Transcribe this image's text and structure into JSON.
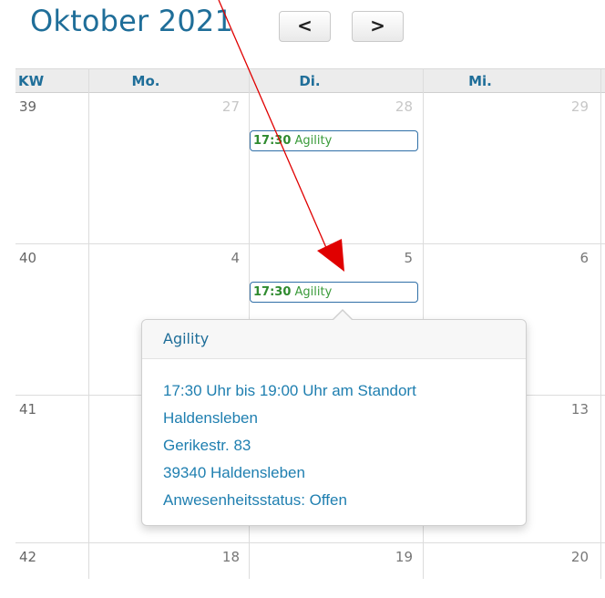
{
  "header": {
    "month_title": "Oktober 2021",
    "prev_icon": "<",
    "next_icon": ">"
  },
  "calendar": {
    "columns": [
      "KW",
      "Mo.",
      "Di.",
      "Mi."
    ],
    "weeks": [
      {
        "kw": "39",
        "days": [
          "27",
          "28",
          "29"
        ]
      },
      {
        "kw": "40",
        "days": [
          "4",
          "5",
          "6"
        ]
      },
      {
        "kw": "41",
        "days": [
          "",
          "",
          "13"
        ]
      },
      {
        "kw": "42",
        "days": [
          "18",
          "19",
          "20"
        ]
      }
    ],
    "events": [
      {
        "time": "17:30",
        "title": "Agility"
      },
      {
        "time": "17:30",
        "title": "Agility"
      }
    ]
  },
  "popover": {
    "title": "Agility",
    "lines": [
      "17:30 Uhr bis 19:00 Uhr am Standort",
      "Haldensleben",
      "Gerikestr. 83",
      "39340 Haldensleben",
      "Anwesenheitsstatus: Offen"
    ]
  },
  "colors": {
    "accent": "#1f6e99",
    "event_text": "#3a9b3a",
    "annotation_arrow": "#e00000"
  }
}
